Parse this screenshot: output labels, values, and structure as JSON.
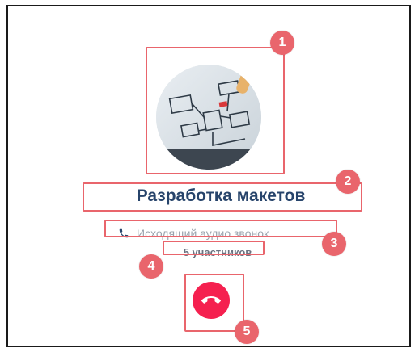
{
  "call": {
    "title": "Разработка макетов",
    "status_text": "Исходящий аудио звонок...",
    "participants": "5 участников",
    "avatar_image": "workflow-diagram-photo",
    "status_icon": "phone-icon",
    "hangup_icon": "phone-hangup-icon"
  },
  "callouts": [
    "1",
    "2",
    "3",
    "4",
    "5"
  ],
  "colors": {
    "highlight": "#e9656c",
    "title": "#27446b",
    "status_text": "#9aa3ad",
    "count_text": "#6b7280",
    "hangup_button": "#f5204f"
  }
}
